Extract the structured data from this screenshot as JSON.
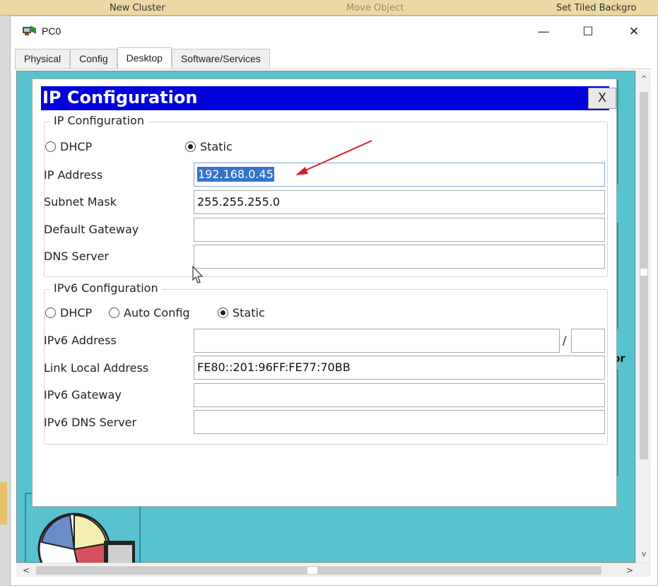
{
  "background_toolbar": {
    "items": [
      "New Cluster",
      "Move Object",
      "Set Tiled Backgro"
    ]
  },
  "window": {
    "title": "PC0",
    "minimize_glyph": "—",
    "maximize_glyph": "☐",
    "close_glyph": "✕",
    "tabs": [
      {
        "label": "Physical",
        "active": false
      },
      {
        "label": "Config",
        "active": false
      },
      {
        "label": "Desktop",
        "active": true
      },
      {
        "label": "Software/Services",
        "active": false
      }
    ]
  },
  "desktop_bg_labels": [
    "-",
    "or",
    "l"
  ],
  "ip_config": {
    "title": "IP Configuration",
    "close_label": "X",
    "ipv4": {
      "legend": "IP Configuration",
      "mode_options": [
        {
          "label": "DHCP",
          "selected": false
        },
        {
          "label": "Static",
          "selected": true
        }
      ],
      "fields": [
        {
          "label": "IP Address",
          "value": "192.168.0.45",
          "selected_text": true
        },
        {
          "label": "Subnet Mask",
          "value": "255.255.255.0"
        },
        {
          "label": "Default Gateway",
          "value": ""
        },
        {
          "label": "DNS Server",
          "value": ""
        }
      ]
    },
    "ipv6": {
      "legend": "IPv6 Configuration",
      "mode_options": [
        {
          "label": "DHCP",
          "selected": false
        },
        {
          "label": "Auto Config",
          "selected": false
        },
        {
          "label": "Static",
          "selected": true
        }
      ],
      "fields": [
        {
          "label": "IPv6 Address",
          "value": "",
          "prefix": "",
          "separator": "/"
        },
        {
          "label": "Link Local Address",
          "value": "FE80::201:96FF:FE77:70BB"
        },
        {
          "label": "IPv6 Gateway",
          "value": ""
        },
        {
          "label": "IPv6 DNS Server",
          "value": ""
        }
      ]
    }
  },
  "scrollbars": {
    "up": "^",
    "down": "v",
    "left": "<",
    "right": ">"
  },
  "colors": {
    "panel_title_bg": "#0000dd",
    "desktop_bg": "#58c3cf",
    "selection": "#3574cc",
    "annotation_arrow": "#d42020"
  },
  "icons": {
    "app": "packet-tracer-pc-icon",
    "annotation": "red-arrow-annotation",
    "pointer": "mouse-cursor-icon"
  }
}
